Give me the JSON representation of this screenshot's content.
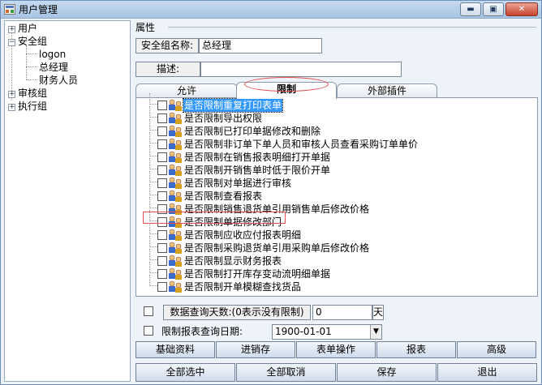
{
  "window": {
    "title": "用户管理",
    "minimize_symbol": "▬",
    "maximize_symbol": "▣",
    "close_symbol": "✕"
  },
  "tree": [
    {
      "toggle": "+",
      "label": "用户"
    },
    {
      "toggle": "−",
      "label": "安全组"
    },
    {
      "toggle": "",
      "label": "logon"
    },
    {
      "toggle": "",
      "label": "总经理"
    },
    {
      "toggle": "",
      "label": "财务人员"
    },
    {
      "toggle": "+",
      "label": "审核组"
    },
    {
      "toggle": "+",
      "label": "执行组"
    }
  ],
  "props": {
    "group_title": "属性",
    "name_label": "安全组名称:",
    "name_value": "总经理",
    "desc_label": "描述:",
    "desc_value": ""
  },
  "tabs": [
    {
      "label": "允许",
      "active": false
    },
    {
      "label": "限制",
      "active": true
    },
    {
      "label": "外部插件",
      "active": false
    }
  ],
  "permissions": [
    {
      "label": "是否限制重复打印表单",
      "checked": false,
      "selected": true
    },
    {
      "label": "是否限制导出权限",
      "checked": false,
      "selected": false
    },
    {
      "label": "是否限制已打印单据修改和删除",
      "checked": false,
      "selected": false
    },
    {
      "label": "是否限制非订单下单人员和审核人员查看采购订单单价",
      "checked": false,
      "selected": false
    },
    {
      "label": "是否限制在销售报表明细打开单据",
      "checked": false,
      "selected": false
    },
    {
      "label": "是否限制开销售单时低于限价开单",
      "checked": false,
      "selected": false
    },
    {
      "label": "是否限制对单据进行审核",
      "checked": false,
      "selected": false
    },
    {
      "label": "是否限制查看报表",
      "checked": false,
      "selected": false
    },
    {
      "label": "是否限制销售退货单引用销售单后修改价格",
      "checked": false,
      "selected": false
    },
    {
      "label": "是否限制单据修改部门",
      "checked": false,
      "selected": false
    },
    {
      "label": "是否限制应收应付报表明细",
      "checked": false,
      "selected": false
    },
    {
      "label": "是否限制采购退货单引用采购单后修改价格",
      "checked": false,
      "selected": false
    },
    {
      "label": "是否限制显示财务报表",
      "checked": false,
      "selected": false
    },
    {
      "label": "是否限制打开库存变动流明细单据",
      "checked": false,
      "selected": false
    },
    {
      "label": "是否限制开单模糊查找货品",
      "checked": false,
      "selected": false
    }
  ],
  "options": {
    "days_label": "数据查询天数:(0表示没有限制)",
    "days_value": "0",
    "days_unit": "天",
    "date_label": "限制报表查询日期:",
    "date_value": "1900-01-01",
    "dropdown_arrow": "▼"
  },
  "category_buttons": [
    "基础资料",
    "进销存",
    "表单操作",
    "报表",
    "高级"
  ],
  "action_buttons": [
    "全部选中",
    "全部取消",
    "保存",
    "退出"
  ],
  "colors": {
    "selection": "#3399ff",
    "annotation": "#e05050"
  }
}
